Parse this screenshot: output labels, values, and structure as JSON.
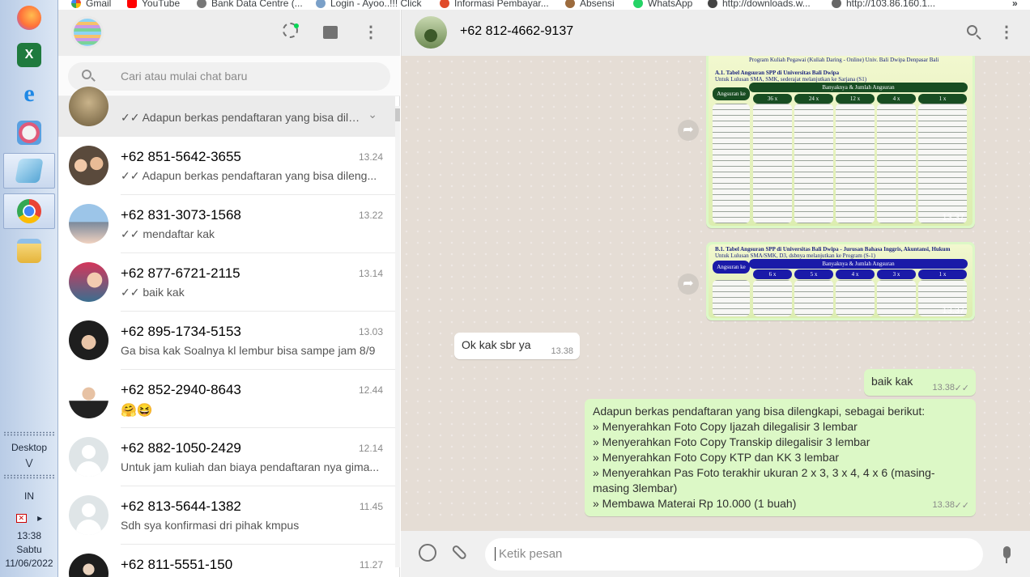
{
  "bookmarks": [
    {
      "label": "Gmail",
      "icon": "google-icon",
      "color": "#4285f4"
    },
    {
      "label": "YouTube",
      "icon": "youtube-icon",
      "color": "#ff0000"
    },
    {
      "label": "Bank Data Centre (...",
      "icon": "bank-icon",
      "color": "#777777"
    },
    {
      "label": "Login - Ayoo..!!! Click",
      "icon": "login-icon",
      "color": "#7aa0c8"
    },
    {
      "label": "Informasi Pembayar...",
      "icon": "info-icon",
      "color": "#e04b2a"
    },
    {
      "label": "Absensi",
      "icon": "absensi-icon",
      "color": "#9c6b3d"
    },
    {
      "label": "WhatsApp",
      "icon": "whatsapp-icon",
      "color": "#25d366"
    },
    {
      "label": "http://downloads.w...",
      "icon": "download-icon",
      "color": "#444444"
    },
    {
      "label": "http://103.86.160.1...",
      "icon": "globe-icon",
      "color": "#666666"
    }
  ],
  "taskbar": {
    "desktop_label": "Desktop",
    "input_lang": "IN",
    "time": "13:38",
    "day": "Sabtu",
    "date": "11/06/2022"
  },
  "sidebar": {
    "search_placeholder": "Cari atau mulai chat baru",
    "pinned_preview": "✓✓ Adapun berkas pendaftaran yang bisa dile...",
    "chats": [
      {
        "name": "+62 851-5642-3655",
        "time": "13.24",
        "preview": "✓✓ Adapun berkas pendaftaran yang bisa dileng..."
      },
      {
        "name": "+62 831-3073-1568",
        "time": "13.22",
        "preview": "✓✓ mendaftar kak"
      },
      {
        "name": "+62 877-6721-2115",
        "time": "13.14",
        "preview": "✓✓ baik kak"
      },
      {
        "name": "+62 895-1734-5153",
        "time": "13.03",
        "preview": "Ga bisa kak  Soalnya kl lembur bisa sampe jam 8/9"
      },
      {
        "name": "+62 852-2940-8643",
        "time": "12.44",
        "preview": "🤗😆"
      },
      {
        "name": "+62 882-1050-2429",
        "time": "12.14",
        "preview": "Untuk jam kuliah dan biaya pendaftaran nya gima..."
      },
      {
        "name": "+62 813-5644-1382",
        "time": "11.45",
        "preview": "Sdh sya konfirmasi dri pihak kmpus"
      },
      {
        "name": "+62 811-5551-150",
        "time": "11.27",
        "preview": ""
      }
    ]
  },
  "conversation": {
    "contact": "+62 812-4662-9137",
    "image1": {
      "subtitle": "Program Kuliah Pegawai (Kuliah Daring - Online) Univ. Bali Dwipa Denpasar Bali",
      "heading": "A.1.  Tabel Angsuran SPP di Universitas Bali Dwipa",
      "subheading": "Untuk Lulusan SMA, SMK, sederajat melanjutkan ke Sarjana (S1)",
      "banner": "Banyaknya & Jumlah Angsuran",
      "row_header": "Angsuran ke",
      "columns": [
        "36 x",
        "24 x",
        "12 x",
        "4 x",
        "1 x"
      ],
      "time": "13.37"
    },
    "image2": {
      "heading": "B.1.  Tabel Angsuran SPP di Universitas Bali Dwipa - Jurusan Bahasa Inggris, Akuntansi, Hukum",
      "subheading": "Untuk Lulusan SMA/SMK, D3, dsbnya melanjutkan ke Program (S-1)",
      "banner": "Banyaknya & Jumlah Angsuran",
      "row_header": "Angsuran ke",
      "columns": [
        "6 x",
        "5 x",
        "4 x",
        "3 x",
        "1 x"
      ],
      "time": "13.37"
    },
    "incoming": {
      "text": "Ok kak sbr ya",
      "time": "13.38"
    },
    "reply": {
      "text": "baik kak",
      "time": "13.38"
    },
    "long_message": {
      "lines": [
        "Adapun berkas pendaftaran yang bisa dilengkapi, sebagai berikut:",
        "» Menyerahkan Foto Copy Ijazah dilegalisir  3 lembar",
        "» Menyerahkan Foto Copy  Transkip dilegalisir   3 lembar",
        "» Menyerahkan Foto Copy KTP dan KK 3 lembar",
        "» Menyerahkan Pas Foto terakhir ukuran 2 x 3, 3 x 4, 4 x 6 (masing-masing 3lembar)",
        "» Membawa Materai Rp 10.000 (1 buah)"
      ],
      "time": "13.38"
    },
    "composer_placeholder": "Ketik pesan"
  },
  "colors": {
    "outgoing": "#dcf8c6",
    "header": "#ededed",
    "chat_bg": "#e5ddd5",
    "read_tick": "#4fc3f7"
  }
}
